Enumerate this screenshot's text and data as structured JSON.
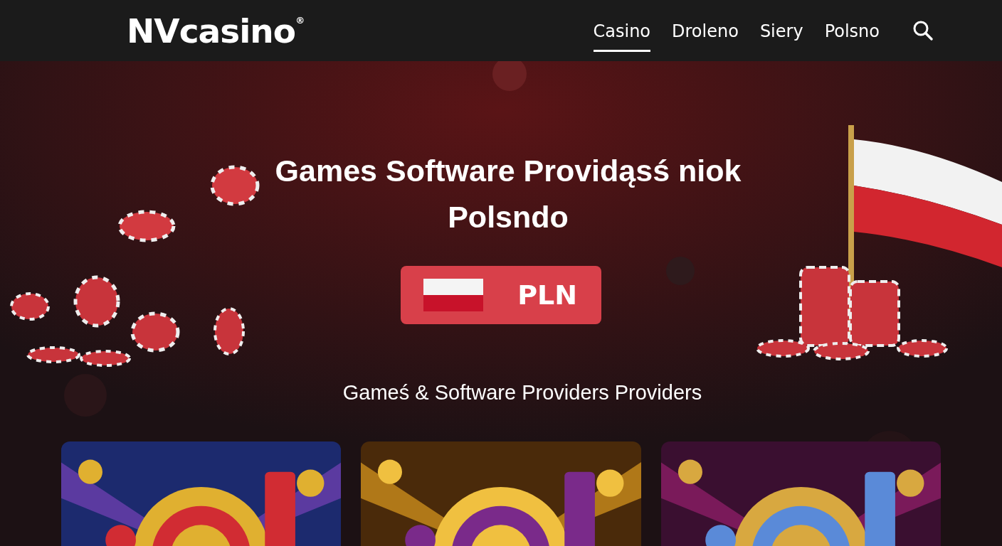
{
  "header": {
    "logo": "NVcasino$^{®}$",
    "nav": [
      {
        "label": "Casino",
        "selected": true
      },
      {
        "label": "Droleno",
        "selected": false
      },
      {
        "label": "Siery",
        "selected": false
      },
      {
        "label": "Polsno",
        "selected": false
      }
    ]
  },
  "hero": {
    "kind": "picture",
    "title": "Games Software Providąsś niok Polsndo",
    "currency_button": "PLN",
    "subtitle": "Gameś & Software Providers Providers"
  }
}
